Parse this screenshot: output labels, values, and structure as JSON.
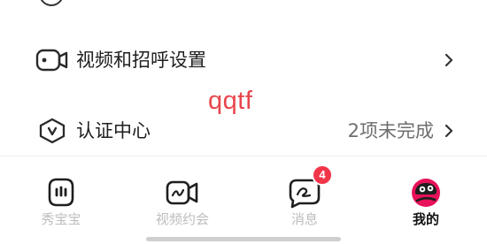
{
  "settings": {
    "items": [
      {
        "label": "视频和招呼设置",
        "value": "",
        "icon": "video-camera-icon"
      },
      {
        "label": "认证中心",
        "value": "2项未完成",
        "icon": "shield-check-icon"
      }
    ]
  },
  "watermark": {
    "text": "qqtf"
  },
  "tabbar": {
    "tabs": [
      {
        "label": "秀宝宝",
        "icon": "baby-face-icon",
        "active": false
      },
      {
        "label": "视频约会",
        "icon": "video-date-icon",
        "active": false
      },
      {
        "label": "消息",
        "icon": "message-bubble-icon",
        "active": false,
        "badge": "4"
      },
      {
        "label": "我的",
        "icon": "profile-avatar-icon",
        "active": true
      }
    ]
  },
  "colors": {
    "accent": "#e8115b",
    "badge": "#f2364a",
    "watermark": "#e8464c",
    "inactive_tab": "#bdbdbd"
  }
}
